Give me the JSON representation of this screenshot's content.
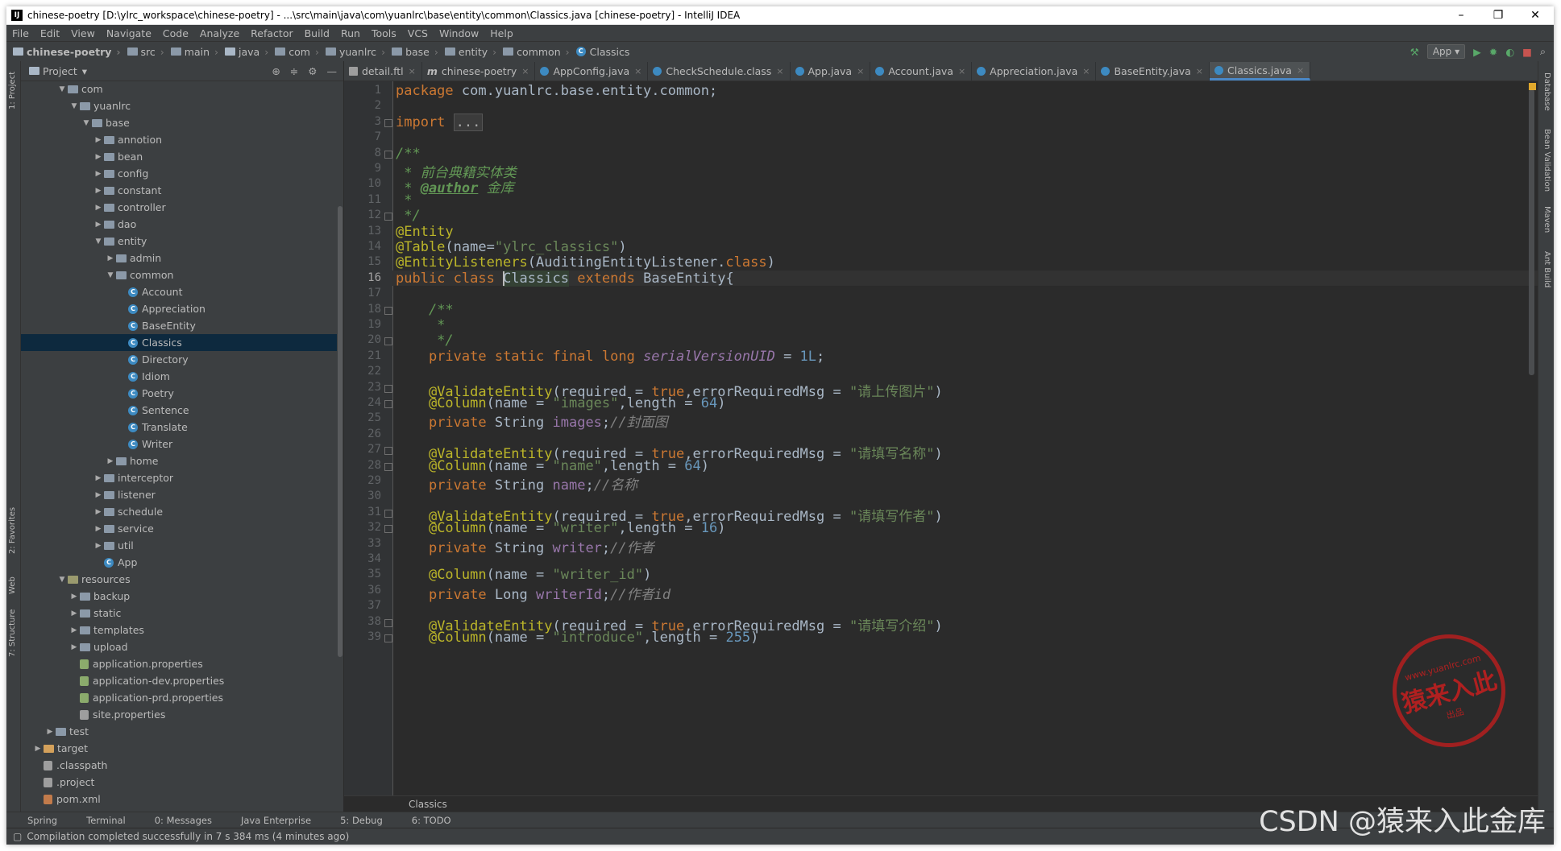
{
  "window": {
    "title": "chinese-poetry [D:\\ylrc_workspace\\chinese-poetry] - ...\\src\\main\\java\\com\\yuanlrc\\base\\entity\\common\\Classics.java [chinese-poetry] - IntelliJ IDEA"
  },
  "menu": [
    "File",
    "Edit",
    "View",
    "Navigate",
    "Code",
    "Analyze",
    "Refactor",
    "Build",
    "Run",
    "Tools",
    "VCS",
    "Window",
    "Help"
  ],
  "navbar": {
    "crumbs": [
      "chinese-poetry",
      "src",
      "main",
      "java",
      "com",
      "yuanlrc",
      "base",
      "entity",
      "common",
      "Classics"
    ],
    "run_config": "App"
  },
  "project": {
    "title": "Project",
    "tree": [
      {
        "label": "com",
        "depth": 2,
        "arrow": "▼",
        "icon": "folder"
      },
      {
        "label": "yuanlrc",
        "depth": 3,
        "arrow": "▼",
        "icon": "folder"
      },
      {
        "label": "base",
        "depth": 4,
        "arrow": "▼",
        "icon": "folder"
      },
      {
        "label": "annotion",
        "depth": 5,
        "arrow": "▶",
        "icon": "folder"
      },
      {
        "label": "bean",
        "depth": 5,
        "arrow": "▶",
        "icon": "folder"
      },
      {
        "label": "config",
        "depth": 5,
        "arrow": "▶",
        "icon": "folder"
      },
      {
        "label": "constant",
        "depth": 5,
        "arrow": "▶",
        "icon": "folder"
      },
      {
        "label": "controller",
        "depth": 5,
        "arrow": "▶",
        "icon": "folder"
      },
      {
        "label": "dao",
        "depth": 5,
        "arrow": "▶",
        "icon": "folder"
      },
      {
        "label": "entity",
        "depth": 5,
        "arrow": "▼",
        "icon": "folder"
      },
      {
        "label": "admin",
        "depth": 6,
        "arrow": "▶",
        "icon": "folder"
      },
      {
        "label": "common",
        "depth": 6,
        "arrow": "▼",
        "icon": "folder"
      },
      {
        "label": "Account",
        "depth": 7,
        "arrow": "",
        "icon": "class"
      },
      {
        "label": "Appreciation",
        "depth": 7,
        "arrow": "",
        "icon": "class"
      },
      {
        "label": "BaseEntity",
        "depth": 7,
        "arrow": "",
        "icon": "class"
      },
      {
        "label": "Classics",
        "depth": 7,
        "arrow": "",
        "icon": "class",
        "selected": true
      },
      {
        "label": "Directory",
        "depth": 7,
        "arrow": "",
        "icon": "class"
      },
      {
        "label": "Idiom",
        "depth": 7,
        "arrow": "",
        "icon": "class"
      },
      {
        "label": "Poetry",
        "depth": 7,
        "arrow": "",
        "icon": "class"
      },
      {
        "label": "Sentence",
        "depth": 7,
        "arrow": "",
        "icon": "class"
      },
      {
        "label": "Translate",
        "depth": 7,
        "arrow": "",
        "icon": "class"
      },
      {
        "label": "Writer",
        "depth": 7,
        "arrow": "",
        "icon": "class"
      },
      {
        "label": "home",
        "depth": 6,
        "arrow": "▶",
        "icon": "folder"
      },
      {
        "label": "interceptor",
        "depth": 5,
        "arrow": "▶",
        "icon": "folder"
      },
      {
        "label": "listener",
        "depth": 5,
        "arrow": "▶",
        "icon": "folder"
      },
      {
        "label": "schedule",
        "depth": 5,
        "arrow": "▶",
        "icon": "folder"
      },
      {
        "label": "service",
        "depth": 5,
        "arrow": "▶",
        "icon": "folder"
      },
      {
        "label": "util",
        "depth": 5,
        "arrow": "▶",
        "icon": "folder"
      },
      {
        "label": "App",
        "depth": 5,
        "arrow": "",
        "icon": "class"
      },
      {
        "label": "resources",
        "depth": 2,
        "arrow": "▼",
        "icon": "res"
      },
      {
        "label": "backup",
        "depth": 3,
        "arrow": "▶",
        "icon": "folder"
      },
      {
        "label": "static",
        "depth": 3,
        "arrow": "▶",
        "icon": "folder"
      },
      {
        "label": "templates",
        "depth": 3,
        "arrow": "▶",
        "icon": "folder"
      },
      {
        "label": "upload",
        "depth": 3,
        "arrow": "▶",
        "icon": "folder"
      },
      {
        "label": "application.properties",
        "depth": 3,
        "arrow": "",
        "icon": "props"
      },
      {
        "label": "application-dev.properties",
        "depth": 3,
        "arrow": "",
        "icon": "props"
      },
      {
        "label": "application-prd.properties",
        "depth": 3,
        "arrow": "",
        "icon": "props"
      },
      {
        "label": "site.properties",
        "depth": 3,
        "arrow": "",
        "icon": "props-gray"
      },
      {
        "label": "test",
        "depth": 1,
        "arrow": "▶",
        "icon": "folder"
      },
      {
        "label": "target",
        "depth": 0,
        "arrow": "▶",
        "icon": "brown"
      },
      {
        "label": ".classpath",
        "depth": 0,
        "arrow": "",
        "icon": "file"
      },
      {
        "label": ".project",
        "depth": 0,
        "arrow": "",
        "icon": "file"
      },
      {
        "label": "pom.xml",
        "depth": 0,
        "arrow": "",
        "icon": "m"
      }
    ]
  },
  "left_strip": {
    "project_tab": "1: Project",
    "favorites_tab": "2: Favorites",
    "web_tab": "Web",
    "structure_tab": "7: Structure"
  },
  "right_strip": {
    "database": "Database",
    "bean_validation": "Bean Validation",
    "maven": "Maven",
    "ant": "Ant Build"
  },
  "tabs": [
    {
      "label": "detail.ftl",
      "icon": "ftl"
    },
    {
      "label": "chinese-poetry",
      "icon": "m"
    },
    {
      "label": "AppConfig.java",
      "icon": "class"
    },
    {
      "label": "CheckSchedule.class",
      "icon": "class"
    },
    {
      "label": "App.java",
      "icon": "class"
    },
    {
      "label": "Account.java",
      "icon": "class"
    },
    {
      "label": "Appreciation.java",
      "icon": "class"
    },
    {
      "label": "BaseEntity.java",
      "icon": "class"
    },
    {
      "label": "Classics.java",
      "icon": "class",
      "active": true
    }
  ],
  "code": {
    "current_line": 16,
    "lines": [
      {
        "n": 1,
        "html": "<span class=\"kw\">package</span> com.yuanlrc.base.entity.common;"
      },
      {
        "n": 2,
        "html": ""
      },
      {
        "n": 3,
        "html": "<span class=\"kw\">import</span> <span class=\"fold-dots\">...</span>"
      },
      {
        "n": 7,
        "html": ""
      },
      {
        "n": 8,
        "html": "<span class=\"doc\">/**</span>"
      },
      {
        "n": 9,
        "html": "<span class=\"doc\"> * 前台典籍实体类</span>"
      },
      {
        "n": 10,
        "html": "<span class=\"doc\"> * </span><span class=\"tag\">@author</span><span class=\"doc\"> 金库</span>"
      },
      {
        "n": 11,
        "html": "<span class=\"doc\"> *</span>"
      },
      {
        "n": 12,
        "html": "<span class=\"doc\"> */</span>"
      },
      {
        "n": 13,
        "html": "<span class=\"ann\">@Entity</span>"
      },
      {
        "n": 14,
        "html": "<span class=\"ann\">@Table</span>(name=<span class=\"str\">\"ylrc_classics\"</span>)"
      },
      {
        "n": 15,
        "html": "<span class=\"ann\">@EntityListeners</span>(AuditingEntityListener.<span class=\"kw\">class</span>)"
      },
      {
        "n": 16,
        "html": "<span class=\"kw\">public class </span><span class=\"cls-ref\">Classics</span> <span class=\"kw\">extends</span> BaseEntity{"
      },
      {
        "n": 17,
        "html": ""
      },
      {
        "n": 18,
        "html": "    <span class=\"doc\">/**</span>"
      },
      {
        "n": 19,
        "html": "<span class=\"doc\">     *</span>"
      },
      {
        "n": 20,
        "html": "<span class=\"doc\">     */</span>"
      },
      {
        "n": 21,
        "html": "    <span class=\"kw\">private static final long </span><span class=\"sfld\">serialVersionUID</span> = <span class=\"num\">1L</span>;"
      },
      {
        "n": 22,
        "html": ""
      },
      {
        "n": 23,
        "html": "    <span class=\"ann\">@ValidateEntity</span>(required = <span class=\"kw\">true</span>,errorRequiredMsg = <span class=\"str\">\"请上传图片\"</span>)"
      },
      {
        "n": 24,
        "html": "    <span class=\"ann\">@Column</span>(name = <span class=\"str\">\"images\"</span>,length = <span class=\"num\">64</span>)"
      },
      {
        "n": 25,
        "html": "    <span class=\"kw\">private </span>String <span class=\"fld\">images</span>;<span class=\"cmt\">//封面图</span>"
      },
      {
        "n": 26,
        "html": ""
      },
      {
        "n": 27,
        "html": "    <span class=\"ann\">@ValidateEntity</span>(required = <span class=\"kw\">true</span>,errorRequiredMsg = <span class=\"str\">\"请填写名称\"</span>)"
      },
      {
        "n": 28,
        "html": "    <span class=\"ann\">@Column</span>(name = <span class=\"str\">\"name\"</span>,length = <span class=\"num\">64</span>)"
      },
      {
        "n": 29,
        "html": "    <span class=\"kw\">private </span>String <span class=\"fld\">name</span>;<span class=\"cmt\">//名称</span>"
      },
      {
        "n": 30,
        "html": ""
      },
      {
        "n": 31,
        "html": "    <span class=\"ann\">@ValidateEntity</span>(required = <span class=\"kw\">true</span>,errorRequiredMsg = <span class=\"str\">\"请填写作者\"</span>)"
      },
      {
        "n": 32,
        "html": "    <span class=\"ann\">@Column</span>(name = <span class=\"str\">\"writer\"</span>,length = <span class=\"num\">16</span>)"
      },
      {
        "n": 33,
        "html": "    <span class=\"kw\">private </span>String <span class=\"fld\">writer</span>;<span class=\"cmt\">//作者</span>"
      },
      {
        "n": 34,
        "html": ""
      },
      {
        "n": 35,
        "html": "    <span class=\"ann\">@Column</span>(name = <span class=\"str\">\"writer_id\"</span>)"
      },
      {
        "n": 36,
        "html": "    <span class=\"kw\">private </span>Long <span class=\"fld\">writerId</span>;<span class=\"cmt\">//作者id</span>"
      },
      {
        "n": 37,
        "html": ""
      },
      {
        "n": 38,
        "html": "    <span class=\"ann\">@ValidateEntity</span>(required = <span class=\"kw\">true</span>,errorRequiredMsg = <span class=\"str\">\"请填写介绍\"</span>)"
      },
      {
        "n": 39,
        "html": "    <span class=\"ann\">@Column</span>(name = <span class=\"str\">\"introduce\"</span>,length = <span class=\"num\">255</span>)"
      }
    ]
  },
  "editor_breadcrumb": "Classics",
  "toolwindows": [
    "Spring",
    "Terminal",
    "0: Messages",
    "Java Enterprise",
    "5: Debug",
    "6: TODO"
  ],
  "status": "Compilation completed successfully in 7 s 384 ms (4 minutes ago)",
  "watermark": "CSDN @猿来入此金库",
  "seal": {
    "top": "www.yuanlrc.com",
    "main": "猿来入此",
    "bottom": "出品"
  },
  "colors": {
    "accent": "#4a88c7",
    "background": "#2b2b2b",
    "panel": "#3c3f41"
  }
}
